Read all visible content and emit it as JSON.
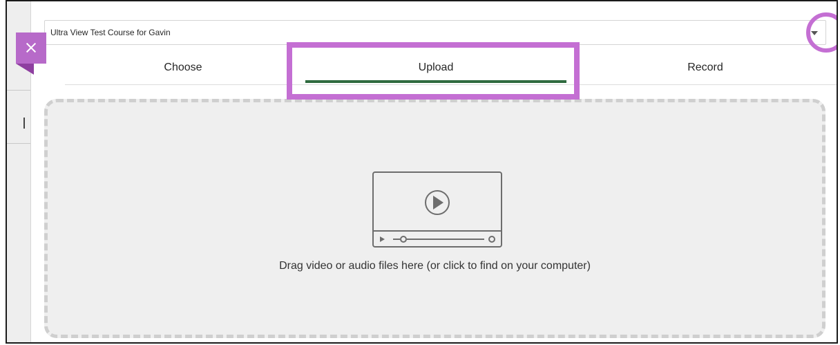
{
  "course_select": {
    "value": "Ultra View Test Course for Gavin"
  },
  "tabs": [
    {
      "label": "Choose",
      "active": false
    },
    {
      "label": "Upload",
      "active": true
    },
    {
      "label": "Record",
      "active": false
    }
  ],
  "dropzone": {
    "text": "Drag video or audio files here (or click to find on your computer)"
  },
  "icons": {
    "close": "close-icon",
    "dropdown": "chevron-down-icon",
    "media": "video-player-icon"
  },
  "colors": {
    "accent_purple": "#b76ac9",
    "highlight": "#c46fd3",
    "active_tab_underline": "#2f6b3f",
    "dropzone_bg": "#efefef"
  }
}
